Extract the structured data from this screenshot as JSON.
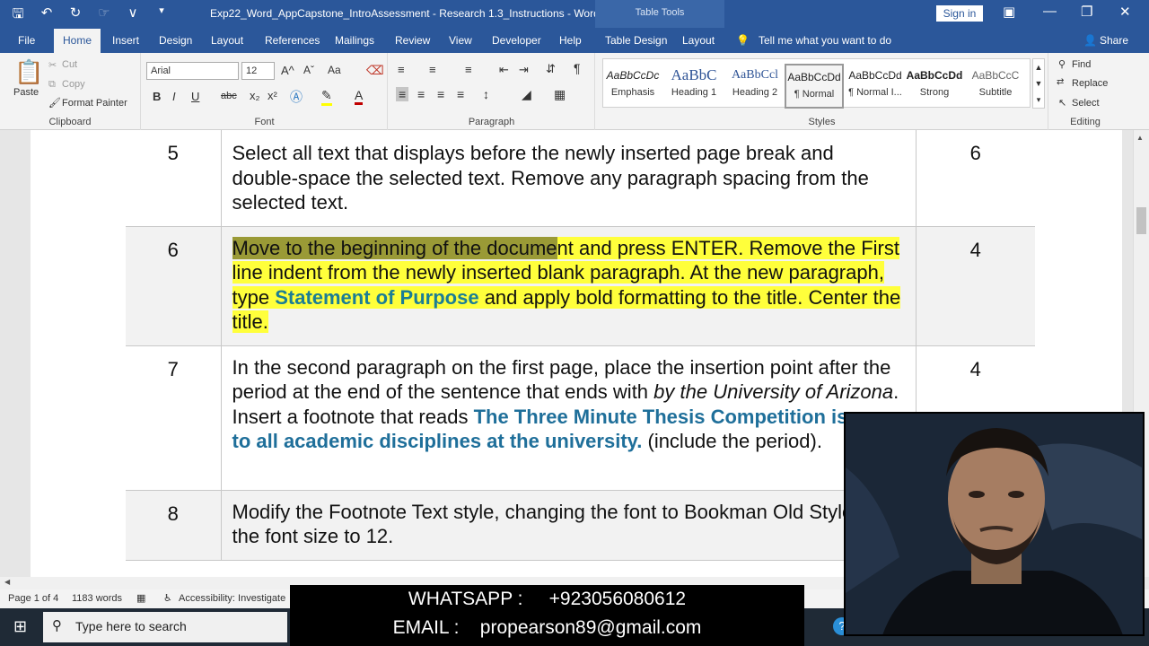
{
  "titlebar": {
    "title": "Exp22_Word_AppCapstone_IntroAssessment - Research 1.3_Instructions  -  Word",
    "table_tools": "Table Tools",
    "sign_in": "Sign in",
    "qat_icons": [
      "save-icon",
      "undo-icon",
      "redo-icon",
      "touch-mode-icon",
      "customize-qat-icon"
    ]
  },
  "tabs": {
    "file": "File",
    "home": "Home",
    "insert": "Insert",
    "design": "Design",
    "layout": "Layout",
    "references": "References",
    "mailings": "Mailings",
    "review": "Review",
    "view": "View",
    "developer": "Developer",
    "help": "Help",
    "table_design": "Table Design",
    "table_layout": "Layout",
    "tell_me": "Tell me what you want to do",
    "share": "Share"
  },
  "clipboard": {
    "paste": "Paste",
    "cut": "Cut",
    "copy": "Copy",
    "format_painter": "Format Painter",
    "label": "Clipboard"
  },
  "font": {
    "name": "Arial",
    "size": "12",
    "label": "Font",
    "bold": "B",
    "italic": "I",
    "underline": "U",
    "strike": "abc",
    "grow": "A^",
    "shrink": "Aˇ",
    "case": "Aa",
    "font_color": "A"
  },
  "paragraph": {
    "label": "Paragraph"
  },
  "styles": {
    "label": "Styles",
    "items": [
      {
        "preview": "AaBbCcDc",
        "name": "Emphasis"
      },
      {
        "preview": "AaBbC",
        "name": "Heading 1"
      },
      {
        "preview": "AaBbCcl",
        "name": "Heading 2"
      },
      {
        "preview": "AaBbCcDd",
        "name": "¶ Normal"
      },
      {
        "preview": "AaBbCcDd",
        "name": "¶ Normal I..."
      },
      {
        "preview": "AaBbCcDd",
        "name": "Strong"
      },
      {
        "preview": "AaBbCcC",
        "name": "Subtitle"
      }
    ]
  },
  "editing": {
    "find": "Find",
    "replace": "Replace",
    "select": "Select",
    "label": "Editing"
  },
  "rows": [
    {
      "num": "5",
      "text": "Select all text that displays before the newly inserted page break and double-space the selected text. Remove any paragraph spacing from the selected text.",
      "points": "6"
    },
    {
      "num": "6",
      "sel_text": "Move to the beginning of the docume",
      "text_a": "nt and press ENTER. Remove the First line indent from the newly inserted blank paragraph. At the new paragraph, type ",
      "bold": "Statement of Purpose",
      "text_b": " and apply bold formatting to the title. Center the title.",
      "points": "4"
    },
    {
      "num": "7",
      "text_a": "In the second paragraph on the first page, place the insertion point after the period at the end of the sentence that ends with ",
      "italic": "by the University of Arizona",
      "text_b": ". Insert a footnote that reads ",
      "bold": "The Three Minute Thesis Competition is open to all academic disciplines at the university.",
      "text_c": " (include the period).",
      "points": "4"
    },
    {
      "num": "8",
      "text": "Modify the Footnote Text style, changing the font to Bookman Old Style and the font size to 12.",
      "points": ""
    }
  ],
  "status": {
    "page": "Page 1 of 4",
    "words": "1183 words",
    "accessibility": "Accessibility: Investigate"
  },
  "taskbar": {
    "search_placeholder": "Type here to search"
  },
  "overlay": {
    "line1": "WHATSAPP :     +923056080612",
    "line2": "EMAIL :    propearson89@gmail.com"
  }
}
